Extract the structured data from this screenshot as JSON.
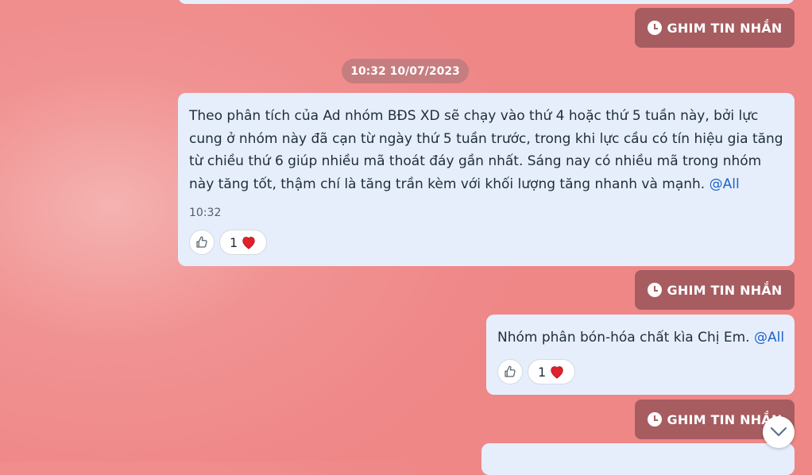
{
  "pin_label": "GHIM TIN NHẮN",
  "date_separator": "10:32 10/07/2023",
  "messages": [
    {
      "text": "Theo phân tích của Ad nhóm BĐS XD sẽ chạy vào thứ 4 hoặc thứ 5 tuần này, bởi lực cung ở nhóm này đã cạn từ ngày thứ 5 tuần trước, trong khi lực cầu có tín hiệu gia tăng từ chiều thứ 6 giúp nhiều mã thoát đáy gần nhất. Sáng nay có nhiều mã trong nhóm này tăng tốt, thậm chí là tăng trần kèm với khối lượng tăng nhanh và mạnh.",
      "mention": "@All",
      "time": "10:32",
      "reaction_count": "1",
      "reaction_icon": "heart-icon"
    },
    {
      "text": "Nhóm phân bón-hóa chất kìa Chị Em.",
      "mention": "@All",
      "reaction_count": "1",
      "reaction_icon": "heart-icon"
    }
  ],
  "colors": {
    "background": "#ef8787",
    "bubble": "#e6eefc",
    "pin_button": "#a75c60",
    "mention": "#1e64c8",
    "heart": "#e0202c"
  }
}
